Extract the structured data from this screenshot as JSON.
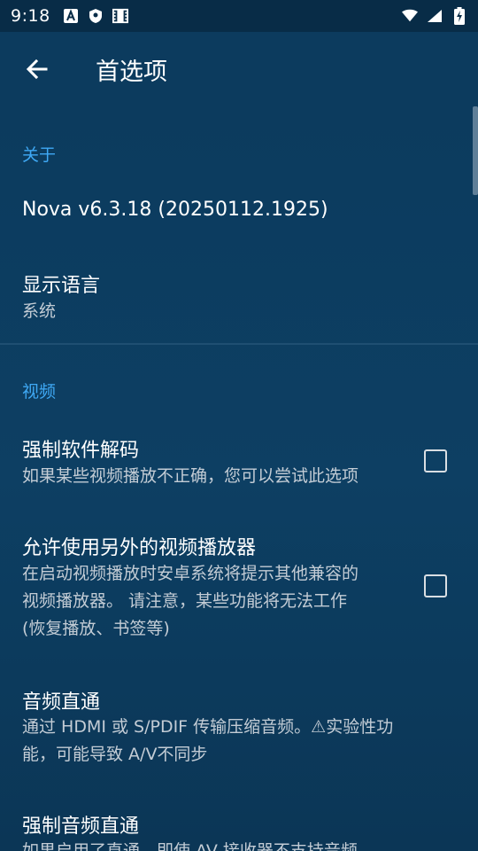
{
  "status_bar": {
    "time": "9:18",
    "left_icons": [
      "a-notification-icon",
      "shield-icon",
      "film-icon"
    ],
    "right_icons": [
      "wifi-icon",
      "signal-icon",
      "battery-charging-icon"
    ]
  },
  "app_bar": {
    "title": "首选项",
    "back_icon": "arrow-back-icon"
  },
  "sections": {
    "about": {
      "header": "关于",
      "version": "Nova v6.3.18 (20250112.1925)",
      "language_title": "显示语言",
      "language_value": "系统"
    },
    "video": {
      "header": "视频",
      "force_sw_title": "强制软件解码",
      "force_sw_summary": "如果某些视频播放不正确，您可以尝试此选项",
      "force_sw_checked": false,
      "alt_player_title": "允许使用另外的视频播放器",
      "alt_player_summary_1": "在启动视频播放时安卓系统将提示其他兼容的",
      "alt_player_summary_2": "视频播放器。 请注意，某些功能将无法工作",
      "alt_player_summary_3": "(恢复播放、书签等)",
      "alt_player_checked": false,
      "passthrough_title": "音频直通",
      "passthrough_summary_1": "通过 HDMI 或 S/PDIF 传输压缩音频。⚠实验性功",
      "passthrough_summary_2": "能，可能导致 A/V不同步",
      "force_passthrough_title": "强制音频直通",
      "force_passthrough_summary": "如果启用了直通，即使 AV 接收器不支持音频"
    }
  },
  "colors": {
    "background": "#0b3a5c",
    "status_bar": "#082c47",
    "accent": "#3fa9f5",
    "summary_text": "#c3ccd5"
  }
}
